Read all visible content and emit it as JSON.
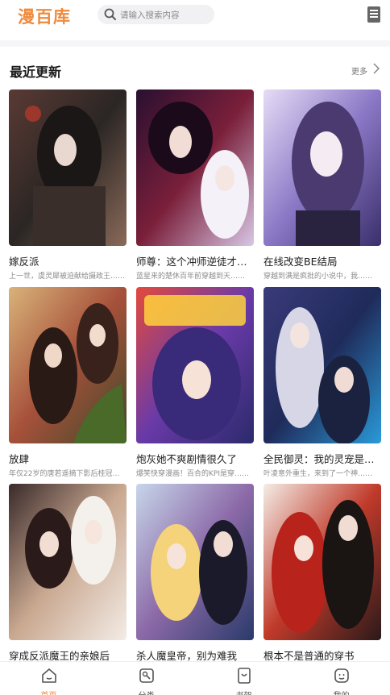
{
  "app": {
    "logo": "漫百库"
  },
  "search": {
    "placeholder": "请输入搜索内容"
  },
  "section": {
    "title": "最近更新",
    "more_label": "更多"
  },
  "comics": [
    {
      "title": "嫁反派",
      "desc": "上一世，虞灵犀被迫献给摄政王……"
    },
    {
      "title": "师尊：这个冲师逆徒才不是圣子",
      "desc": "蓝星来的楚休百年前穿越到天……"
    },
    {
      "title": "在线改变BE结局",
      "desc": "穿越到满是疯批的小说中，我……"
    },
    {
      "title": "放肆",
      "desc": "年仅22岁的唐若遥摘下影后桂冠……"
    },
    {
      "title": "炮灰她不爽剧情很久了",
      "desc": "爆笑快穿漫画！百合的KPI是穿……"
    },
    {
      "title": "全民御灵：我的灵宠是女魔头",
      "desc": "叶凌意外重生，来到了一个神……"
    },
    {
      "title": "穿成反派魔王的亲娘后",
      "desc": ""
    },
    {
      "title": "杀人魔皇帝，别为难我",
      "desc": ""
    },
    {
      "title": "根本不是普通的穿书",
      "desc": ""
    }
  ],
  "tabs": [
    {
      "label": "首页"
    },
    {
      "label": "分类"
    },
    {
      "label": "书架"
    },
    {
      "label": "我的"
    }
  ],
  "colors": {
    "accent": "#f08a3c",
    "muted": "#8c8c8c"
  }
}
